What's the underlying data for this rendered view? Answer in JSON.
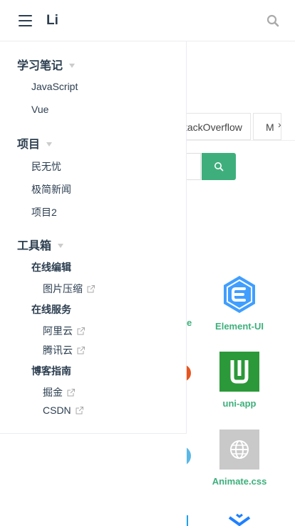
{
  "navbar": {
    "site_name": "Li"
  },
  "sidebar": {
    "groups": [
      {
        "title": "学习笔记",
        "items": [
          "JavaScript",
          "Vue"
        ]
      },
      {
        "title": "项目",
        "items": [
          "民无忧",
          "极简新闻",
          "项目2"
        ]
      },
      {
        "title": "工具箱",
        "subgroups": [
          {
            "title": "在线编辑",
            "items": [
              "图片压缩"
            ]
          },
          {
            "title": "在线服务",
            "items": [
              "阿里云",
              "腾讯云"
            ]
          },
          {
            "title": "博客指南",
            "items": [
              "掘金",
              "CSDN"
            ]
          }
        ]
      }
    ]
  },
  "background": {
    "tabs": [
      "tackOverflow",
      "M"
    ],
    "partial_label": "e",
    "cards": [
      {
        "label": "Element-UI",
        "icon": "element-ui-logo"
      },
      {
        "label": "uni-app",
        "icon": "uni-app-logo"
      },
      {
        "label": "Animate.css",
        "icon": "globe-icon"
      }
    ]
  },
  "colors": {
    "accent": "#3eaf7c",
    "text": "#2c3e50",
    "element_blue": "#409eff",
    "uni_green": "#2b9939"
  }
}
